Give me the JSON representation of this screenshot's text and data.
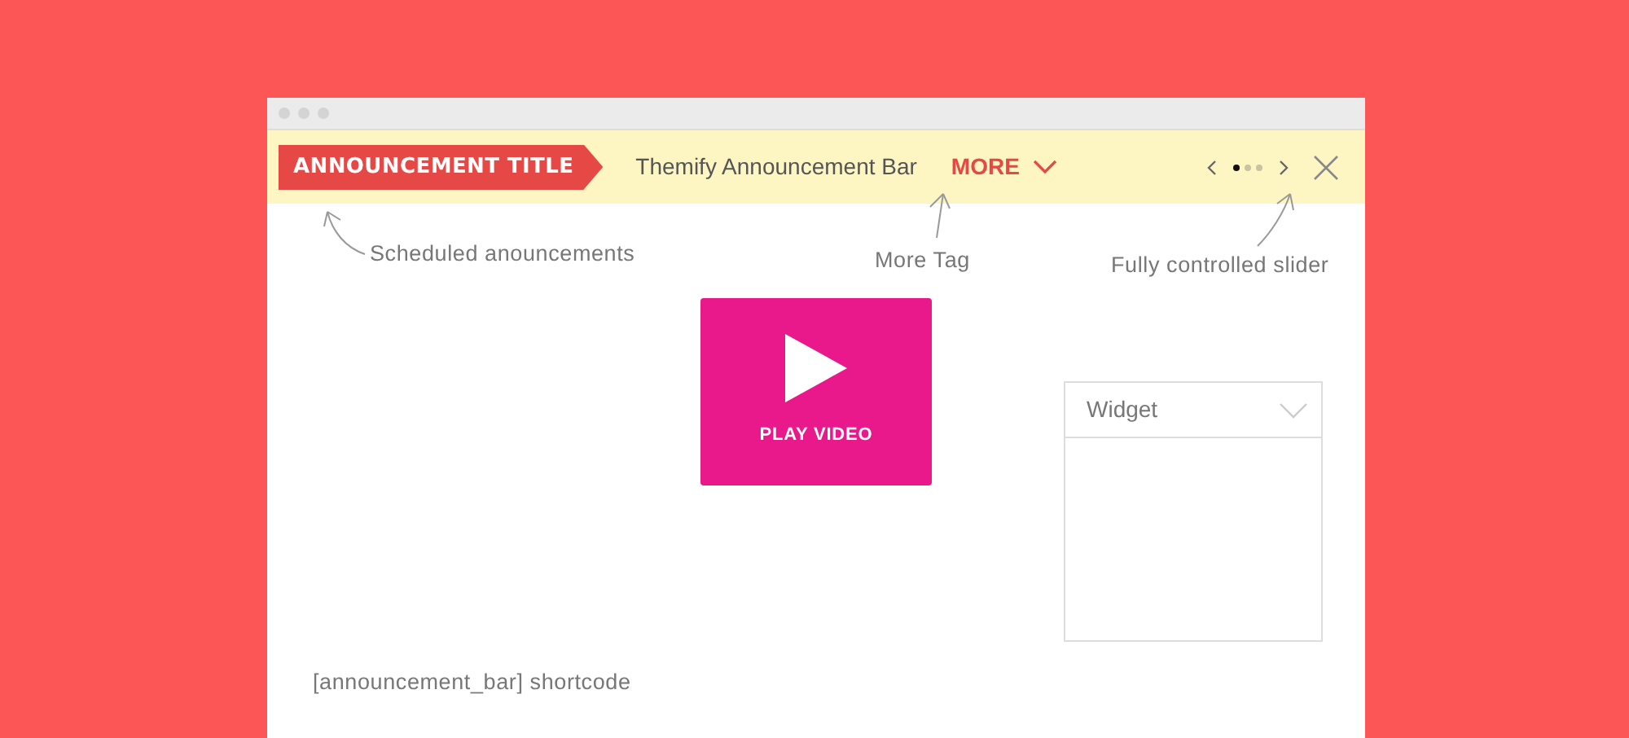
{
  "announcement_bar": {
    "title": "ANNOUNCEMENT TITLE",
    "text": "Themify Announcement Bar",
    "more": "MORE",
    "slider_dots": [
      {
        "selected": true
      },
      {
        "selected": false
      },
      {
        "selected": false
      }
    ]
  },
  "annotations": [
    "Scheduled anouncements",
    "More Tag",
    "Fully controlled slider"
  ],
  "video_button": {
    "label": "PLAY VIDEO"
  },
  "widget": {
    "title": "Widget"
  },
  "shortcode": "[announcement_bar] shortcode"
}
